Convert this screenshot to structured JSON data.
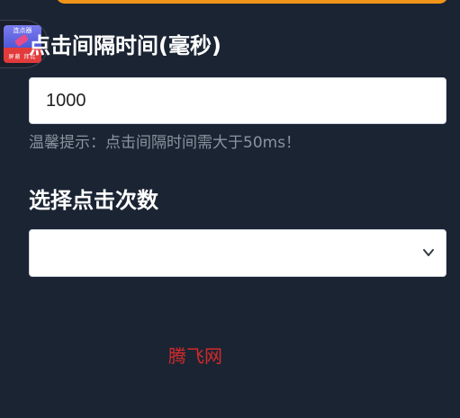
{
  "app_badge": {
    "icon_name": "app-logo-icon",
    "title": "连点器",
    "subtitle": "屏蔽 拜比"
  },
  "interval": {
    "label": "点击间隔时间(毫秒)",
    "value": "1000",
    "hint": "温馨提示：点击间隔时间需大于50ms！"
  },
  "count": {
    "label": "选择点击次数",
    "selected": ""
  },
  "watermark": "腾飞网",
  "colors": {
    "background": "#1b2433",
    "accent": "#f29418",
    "watermark": "#d42a2a",
    "hint": "#8a939f"
  }
}
